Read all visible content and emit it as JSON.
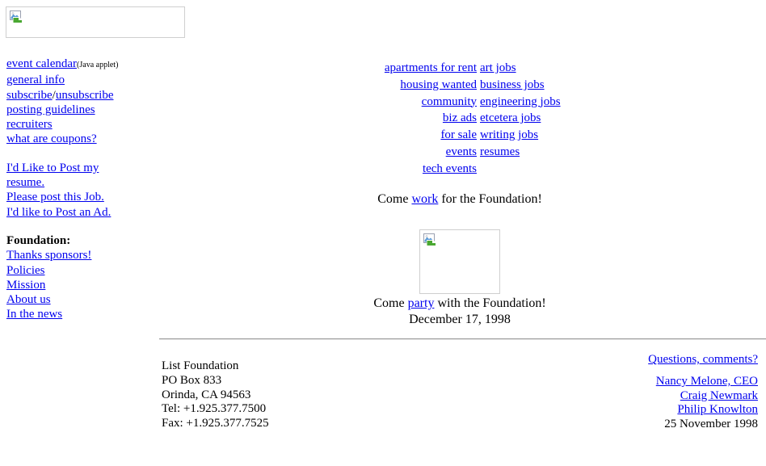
{
  "banner": {
    "icon": "broken-image-icon",
    "alt": ""
  },
  "left_nav": {
    "items": [
      {
        "label": "event calendar",
        "note": "(Java applet)"
      },
      {
        "label": "general info"
      },
      {
        "label": "subscribe",
        "separator": "/",
        "label2": "unsubscribe"
      },
      {
        "label": "posting guidelines"
      },
      {
        "label": "recruiters"
      },
      {
        "label": "what are coupons?"
      }
    ],
    "post_items": [
      {
        "label": "I'd Like to Post my resume."
      },
      {
        "label": "Please post this Job."
      },
      {
        "label": "I'd like to Post an Ad."
      }
    ],
    "foundation_heading": "Foundation:",
    "foundation_items": [
      {
        "label": "Thanks sponsors!"
      },
      {
        "label": "Policies"
      },
      {
        "label": "Mission"
      },
      {
        "label": "About us"
      },
      {
        "label": "In the news"
      }
    ]
  },
  "categories": [
    {
      "left": "apartments for rent",
      "right": "art jobs"
    },
    {
      "left": "housing wanted",
      "right": "business jobs"
    },
    {
      "left": "community",
      "right": "engineering jobs"
    },
    {
      "left": "biz ads",
      "right": "etcetera jobs"
    },
    {
      "left": "for sale",
      "right": "writing jobs"
    },
    {
      "left": "events",
      "right": "resumes"
    },
    {
      "left": "tech events",
      "right": ""
    }
  ],
  "work_line": {
    "before": "Come ",
    "link": "work",
    "after": " for the Foundation!"
  },
  "center_image": {
    "icon": "broken-image-icon",
    "alt": ""
  },
  "party_line": {
    "before": "Come ",
    "link": "party",
    "after": " with the Foundation!",
    "date": "December 17, 1998"
  },
  "footer": {
    "address": "List Foundation\nPO Box 833\nOrinda, CA 94563\nTel: +1.925.377.7500\nFax: +1.925.377.7525",
    "questions_link": "Questions, comments?",
    "people": [
      "Nancy Melone, CEO",
      "Craig Newmark",
      "Philip Knowlton"
    ],
    "date": "25 November 1998"
  },
  "colors": {
    "link": "#0000ee",
    "text": "#000000",
    "background": "#ffffff",
    "rule": "#9b9b9b"
  }
}
